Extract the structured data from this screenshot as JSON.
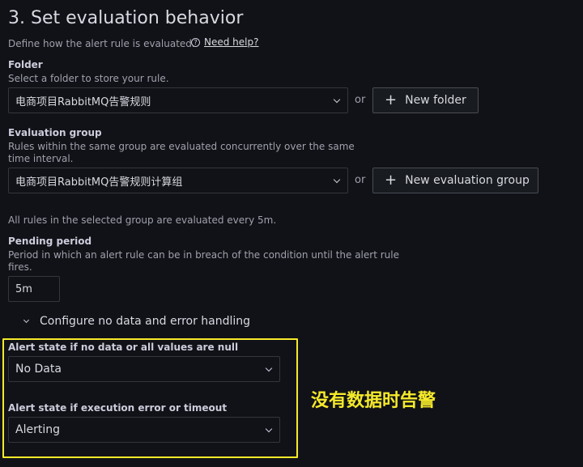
{
  "section": {
    "title": "3. Set evaluation behavior",
    "description": "Define how the alert rule is evaluated.",
    "help_link": "Need help?",
    "help_icon": "?"
  },
  "folder": {
    "label": "Folder",
    "description": "Select a folder to store your rule.",
    "value": "电商项目RabbitMQ告警规则",
    "or": "or",
    "new_button": "New folder"
  },
  "evaluation_group": {
    "label": "Evaluation group",
    "description_line1": "Rules within the same group are evaluated concurrently over the same",
    "description_line2": "time interval.",
    "value": "电商项目RabbitMQ告警规则计算组",
    "or": "or",
    "new_button": "New evaluation group",
    "info": "All rules in the selected group are evaluated every 5m."
  },
  "pending_period": {
    "label": "Pending period",
    "description_line1": "Period in which an alert rule can be in breach of the condition until the alert rule",
    "description_line2": "fires.",
    "value": "5m"
  },
  "no_data_section": {
    "toggle_label": "Configure no data and error handling",
    "no_data_label": "Alert state if no data or all values are null",
    "no_data_value": "No Data",
    "error_label": "Alert state if execution error or timeout",
    "error_value": "Alerting"
  },
  "annotation": {
    "text": "没有数据时告警",
    "color": "#f5ea2a"
  },
  "colors": {
    "background": "#111217",
    "border": "#34363d",
    "highlight": "#f5ea2a"
  }
}
